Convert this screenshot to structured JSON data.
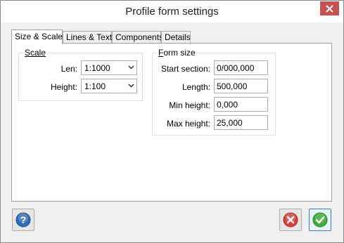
{
  "window": {
    "title": "Profile form settings"
  },
  "tabs": [
    {
      "label": "Size & Scale",
      "active": true
    },
    {
      "label": "Lines & Text",
      "active": false
    },
    {
      "label": "Components",
      "active": false
    },
    {
      "label": "Details",
      "active": false
    }
  ],
  "scale": {
    "legend": "Scale",
    "len_label": "Len:",
    "len_value": "1:1000",
    "height_label": "Height:",
    "height_value": "1:100"
  },
  "form_size": {
    "legend": "Form size",
    "fields": [
      {
        "label": "Start section:",
        "value": "0/000,000"
      },
      {
        "label": "Length:",
        "value": "500,000"
      },
      {
        "label": "Min height:",
        "value": "0,000"
      },
      {
        "label": "Max height:",
        "value": "25,000"
      }
    ]
  },
  "icons": {
    "close": "close-icon",
    "help": "help-icon",
    "cancel": "cancel-icon",
    "ok": "checkmark-icon"
  },
  "colors": {
    "close_button": "#c75050",
    "help_blue": "#2f6db5",
    "cancel_red": "#d9423b",
    "ok_green": "#3fae3a"
  }
}
